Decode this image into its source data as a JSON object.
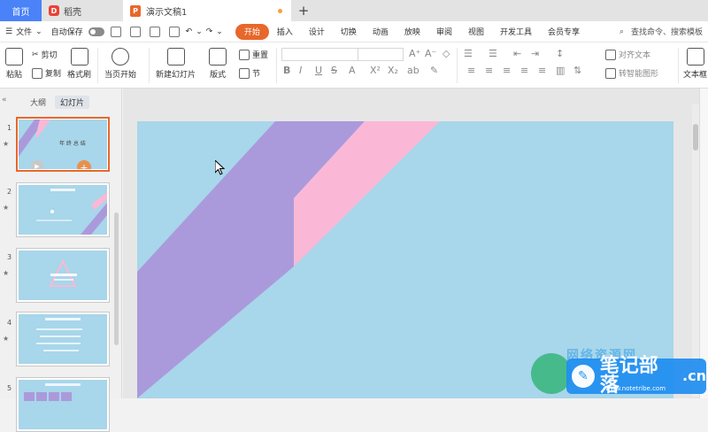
{
  "tabs": {
    "home": "首页",
    "docer": "稻壳",
    "docer_logo": "D",
    "doc_title": "演示文稿1",
    "ppt_logo": "P",
    "new_tab": "+"
  },
  "menu": {
    "file": "文件",
    "autosave": "自动保存",
    "ribbon_tabs": [
      "开始",
      "插入",
      "设计",
      "切换",
      "动画",
      "放映",
      "审阅",
      "视图",
      "开发工具",
      "会员专享"
    ],
    "search": "查找命令、搜索模板"
  },
  "ribbon": {
    "paste": "粘贴",
    "cut": "剪切",
    "copy": "复制",
    "format_painter": "格式刷",
    "from_current": "当页开始",
    "new_slide": "新建幻灯片",
    "layout": "版式",
    "reset": "重置",
    "section": "节",
    "bold": "B",
    "italic": "I",
    "underline": "U",
    "strike": "S",
    "font_color": "A",
    "superscript": "X²",
    "subscript": "X₂",
    "align_text": "对齐文本",
    "smart_shape": "转智能图形",
    "textbox": "文本框"
  },
  "panel": {
    "outline": "大纲",
    "slides": "幻灯片",
    "collapse": "«",
    "slide_numbers": [
      "1",
      "2",
      "3",
      "4",
      "5"
    ],
    "slide1_title": "年 终 总 结"
  },
  "watermark": {
    "text": "笔记部落",
    "sub": "www.notetribe.com",
    "suffix": ".cn",
    "top": "网络资源网"
  },
  "colors": {
    "accent": "#e8672a",
    "slide_bg": "#a8d6ea",
    "stripe_purple": "#ab9adb",
    "stripe_pink": "#fbb8d6"
  }
}
